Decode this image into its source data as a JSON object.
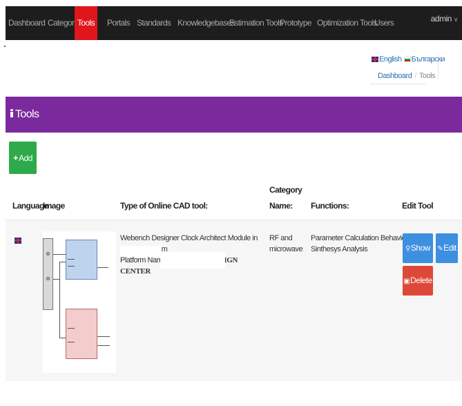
{
  "nav": {
    "items": [
      "Dashboard",
      "Category",
      "Tools",
      "Portals",
      "Standards",
      "Knowledgebases",
      "Estimation Tools",
      "Prototype",
      "Optimization Tools",
      "Users"
    ],
    "active": "Tools",
    "user": "admin"
  },
  "language": {
    "english": "English",
    "bulgarian": "Български"
  },
  "breadcrumb": {
    "home": "Dashboard",
    "current": "Tools"
  },
  "panel": {
    "title": "Tools"
  },
  "actions": {
    "add_label": "Add"
  },
  "table": {
    "headers": {
      "language": "Language",
      "image": "Image",
      "type": "Type of Online CAD tool:",
      "category_line1": "Category",
      "category_line2": "Name:",
      "functions": "Functions:",
      "edit": "Edit Tool"
    },
    "rows": [
      {
        "language_flag": "uk-flag-icon",
        "description": "Webench Designer Clock Architect Module in Online Platform",
        "platform_prefix": "Platform Name:",
        "platform_name": "WEBENCH DESIGN CENTER",
        "category_line1": "RF and",
        "category_line2": "microwave",
        "functions_line1": "Parameter Calculation Behavior",
        "functions_line2": "Sinthesys Analysis",
        "show_label": "Show",
        "edit_label": "Edit",
        "delete_label": "Delete"
      }
    ]
  },
  "colors": {
    "navbar": "#1d1d1d",
    "nav_active": "#e0161d",
    "panel_header": "#7b2a9e",
    "add_button": "#2eaa4a",
    "show_edit_button": "#3d8fe0",
    "delete_button": "#de4838"
  }
}
